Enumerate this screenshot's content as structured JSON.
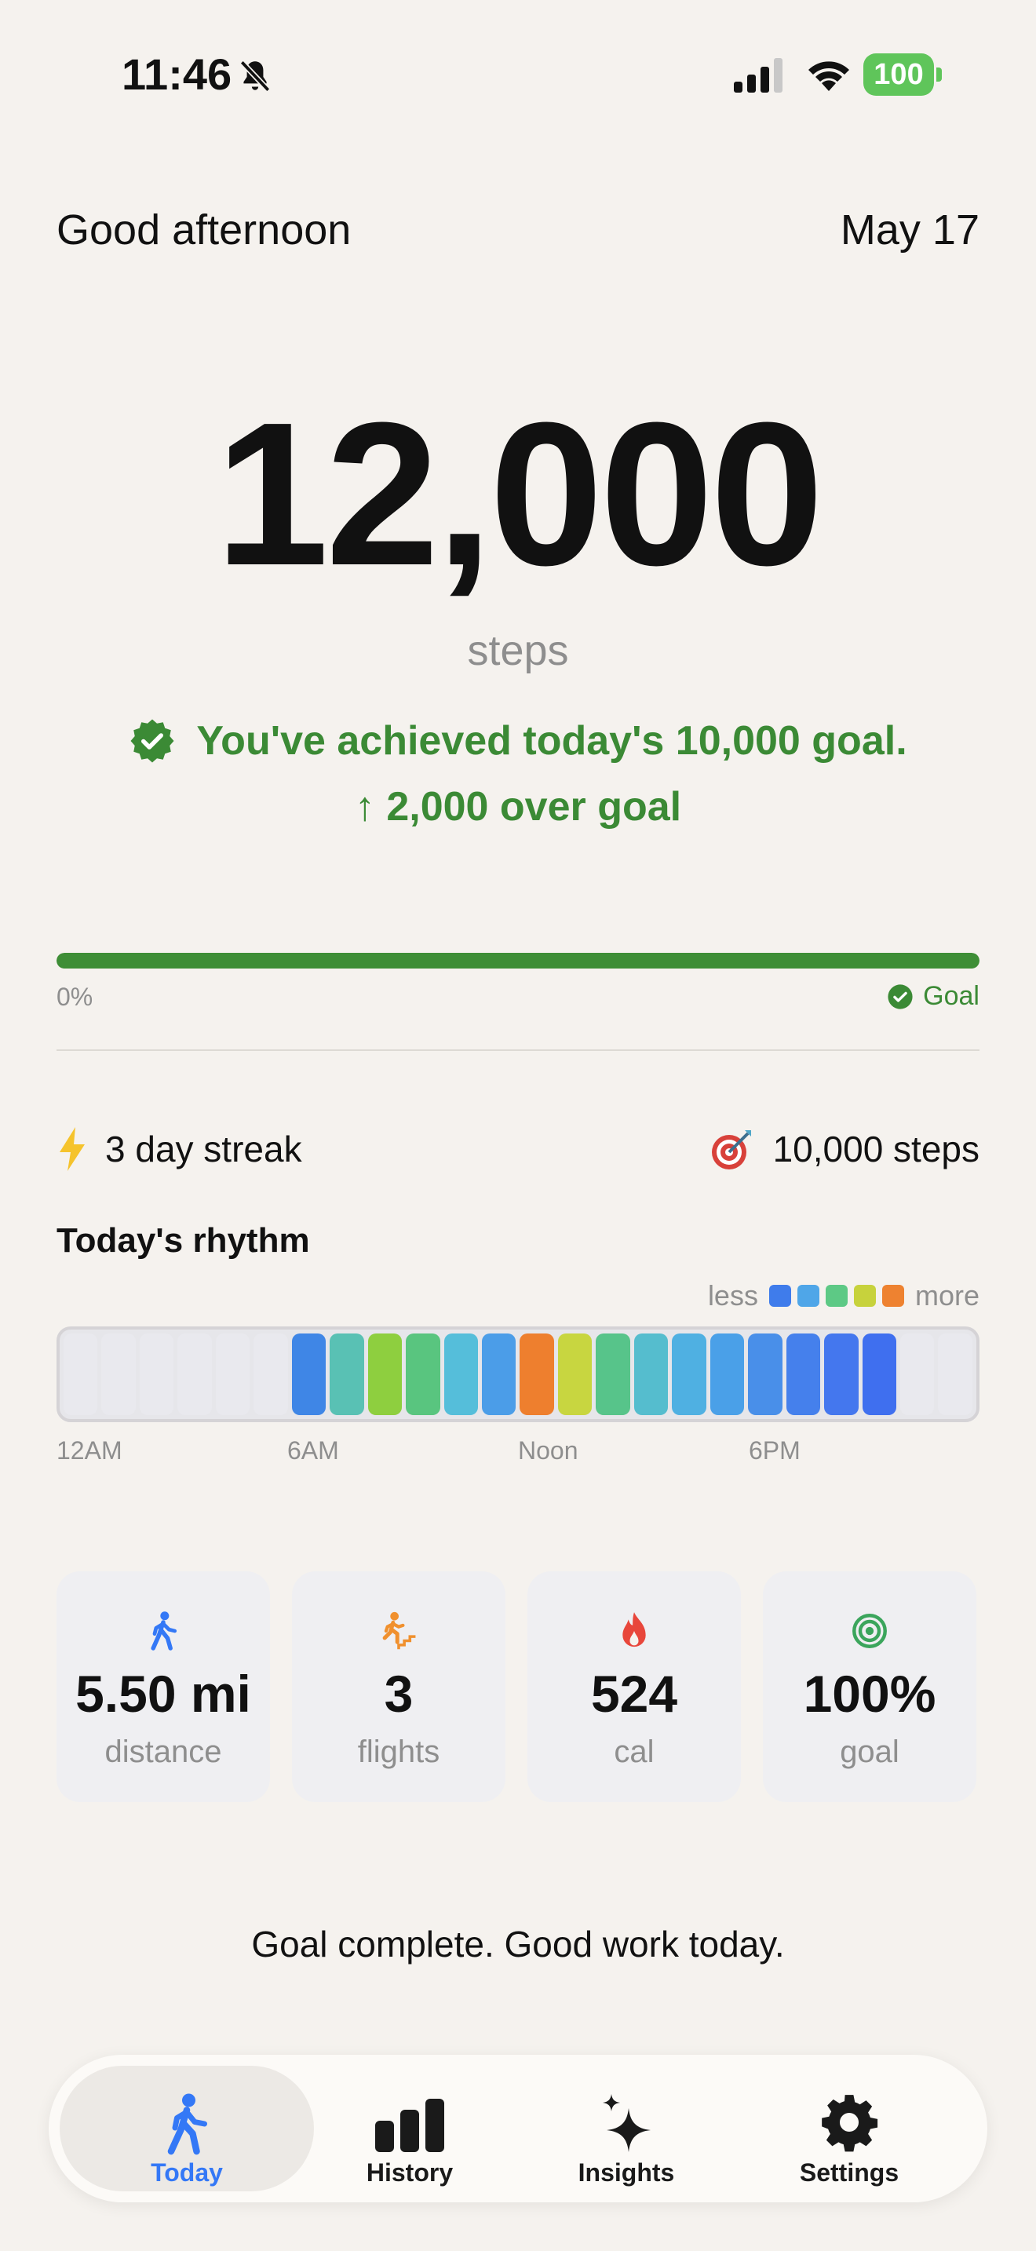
{
  "status_bar": {
    "time": "11:46",
    "battery": "100"
  },
  "header": {
    "greeting": "Good afternoon",
    "date": "May 17"
  },
  "steps": {
    "count": "12,000",
    "unit": "steps"
  },
  "goal_status": {
    "achieved_text": "You've achieved today's 10,000 goal.",
    "over_goal_text": "↑ 2,000 over goal"
  },
  "progress": {
    "fraction": 1.0,
    "start_label": "0%",
    "end_label": "Goal"
  },
  "streak": {
    "label": "3 day streak",
    "goal_label": "10,000 steps"
  },
  "rhythm": {
    "title": "Today's rhythm",
    "legend_less": "less",
    "legend_more": "more",
    "legend_colors": [
      "#3F7CEB",
      "#4FA6E8",
      "#5DC985",
      "#C7D23C",
      "#EE8230"
    ],
    "hour_colors": [
      null,
      null,
      null,
      null,
      null,
      null,
      "#3F86E6",
      "#59C1B4",
      "#8ECF3F",
      "#59C57F",
      "#55BEDA",
      "#4B9DE8",
      "#EE7F2E",
      "#C8D640",
      "#57C48A",
      "#55BDCE",
      "#4FB0E2",
      "#4AA0E8",
      "#498FE9",
      "#4580EC",
      "#4477EE",
      "#3F6FEF",
      null,
      null
    ],
    "axis_labels": [
      "12AM",
      "6AM",
      "Noon",
      "6PM"
    ]
  },
  "stats": [
    {
      "icon": "walking-icon",
      "value": "5.50 mi",
      "label": "distance",
      "color": "#3478F6"
    },
    {
      "icon": "stairs-icon",
      "value": "3",
      "label": "flights",
      "color": "#F0902E"
    },
    {
      "icon": "flame-icon",
      "value": "524",
      "label": "cal",
      "color": "#E8463B"
    },
    {
      "icon": "target-icon",
      "value": "100%",
      "label": "goal",
      "color": "#3BA55C"
    }
  ],
  "footer_message": "Goal complete. Good work today.",
  "tabs": [
    {
      "label": "Today",
      "icon": "walking-icon",
      "active": true
    },
    {
      "label": "History",
      "icon": "bar-chart-icon",
      "active": false
    },
    {
      "label": "Insights",
      "icon": "sparkle-icon",
      "active": false
    },
    {
      "label": "Settings",
      "icon": "gear-icon",
      "active": false
    }
  ]
}
